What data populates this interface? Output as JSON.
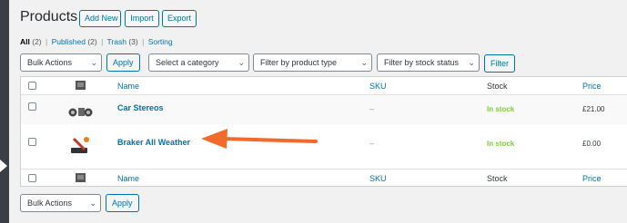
{
  "header": {
    "title": "Products",
    "add_new": "Add New",
    "import": "Import",
    "export": "Export"
  },
  "status_links": {
    "all": "All",
    "all_count": "(2)",
    "published": "Published",
    "published_count": "(2)",
    "trash": "Trash",
    "trash_count": "(3)",
    "sorting": "Sorting",
    "separator": "|"
  },
  "filters": {
    "bulk_actions": "Bulk Actions",
    "apply": "Apply",
    "category": "Select a category",
    "product_type": "Filter by product type",
    "stock_status": "Filter by stock status",
    "filter": "Filter"
  },
  "table": {
    "columns": {
      "name": "Name",
      "sku": "SKU",
      "stock": "Stock",
      "price": "Price"
    },
    "rows": [
      {
        "name": "Car Stereos",
        "sku": "–",
        "stock": "In stock",
        "price": "£21.00",
        "thumb_icon": "car-stereos-thumbnail"
      },
      {
        "name": "Braker All Weather",
        "sku": "–",
        "stock": "In stock",
        "price": "£0.00",
        "thumb_icon": "brake-tool-thumbnail"
      }
    ]
  },
  "bottom_actions": {
    "bulk_actions": "Bulk Actions",
    "apply": "Apply"
  },
  "colors": {
    "link": "#0073aa",
    "in_stock": "#7ad03a",
    "annotation_arrow": "#f26b2a"
  }
}
